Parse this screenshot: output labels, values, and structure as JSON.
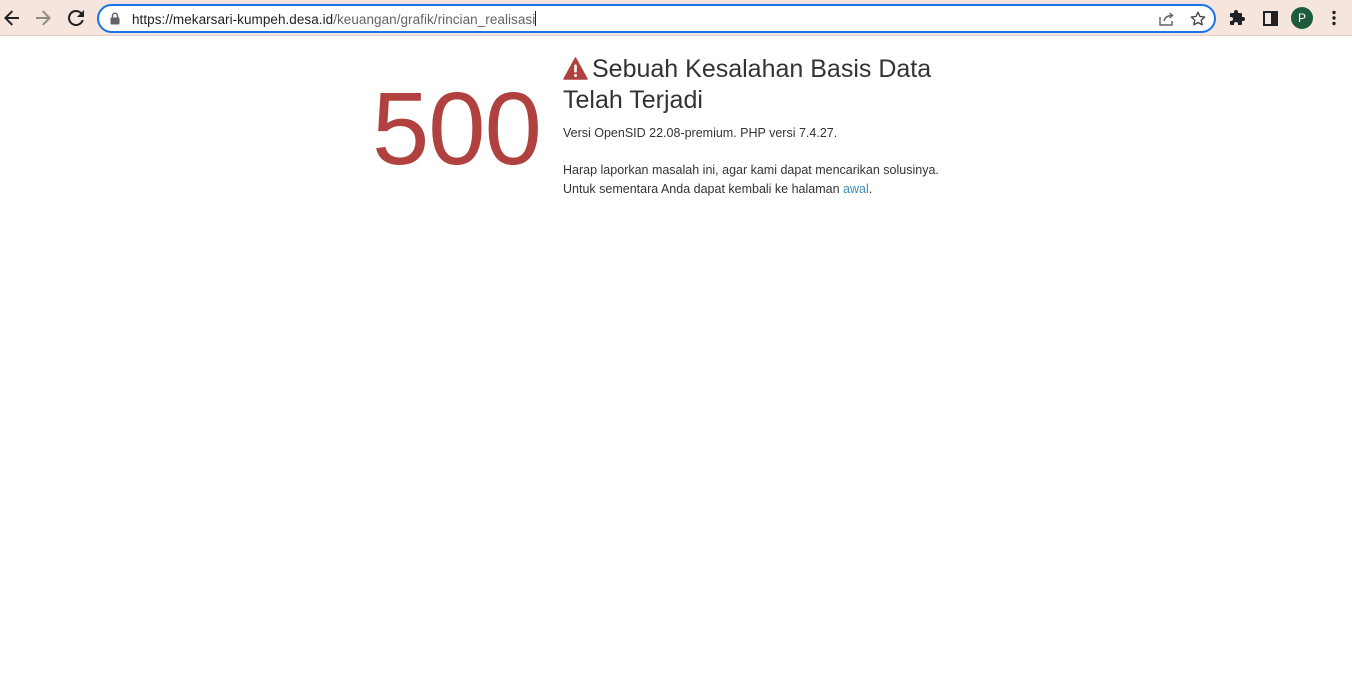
{
  "browser": {
    "url_host": "https://mekarsari-kumpeh.desa.id",
    "url_path": "/keuangan/grafik/rincian_realisasi",
    "profile_initial": "P",
    "icons": [
      "back-arrow-icon",
      "forward-arrow-icon",
      "reload-icon",
      "lock-icon",
      "share-icon",
      "star-icon",
      "extensions-puzzle-icon",
      "side-panel-icon",
      "kebab-menu-icon"
    ],
    "accent_color": "#1a73e8",
    "toolbar_color": "#f6e5dd"
  },
  "error_page": {
    "code": "500",
    "title": "Sebuah Kesalahan Basis Data Telah Terjadi",
    "version_text": "Versi OpenSID 22.08-premium. PHP versi 7.4.27.",
    "report_line1": "Harap laporkan masalah ini, agar kami dapat mencarikan solusinya.",
    "report_line2_prefix": "Untuk sementara Anda dapat kembali ke halaman ",
    "report_link": "awal",
    "report_line2_suffix": ".",
    "icon": "warning-triangle-icon",
    "code_color": "#b0413e",
    "link_color": "#3c8dbc"
  }
}
